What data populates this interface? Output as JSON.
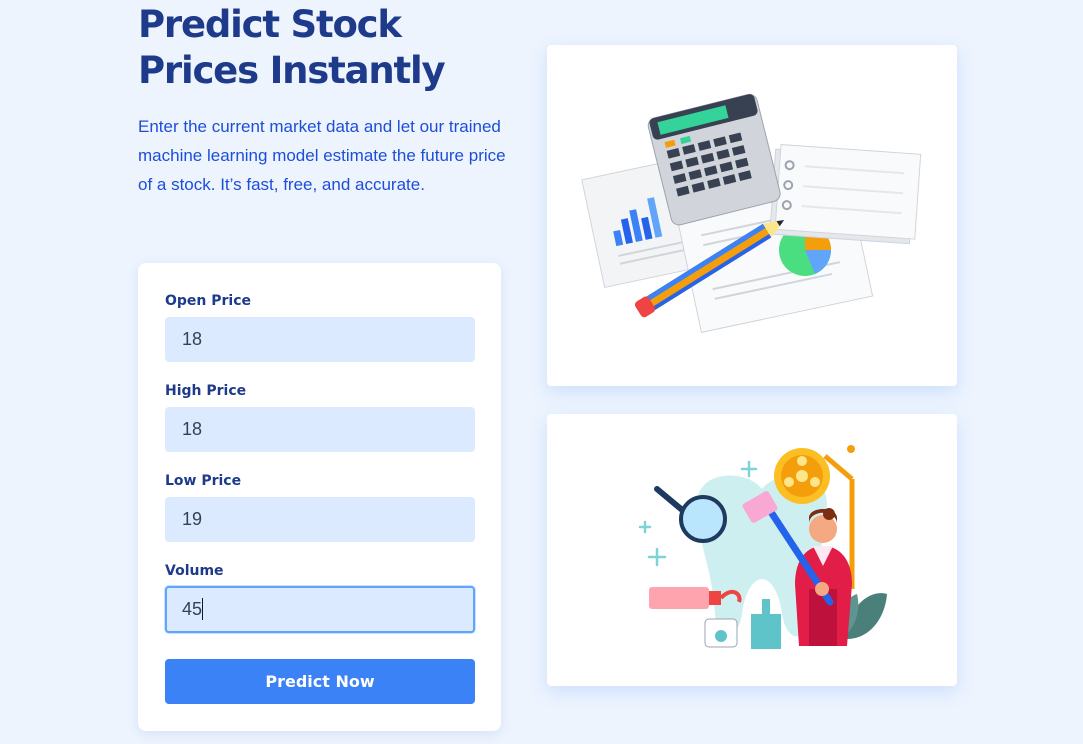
{
  "hero": {
    "title": "Predict Stock Prices Instantly",
    "description": "Enter the current market data and let our trained machine learning model estimate the future price of a stock. It’s fast, free, and accurate."
  },
  "form": {
    "fields": [
      {
        "label": "Open Price",
        "value": "18"
      },
      {
        "label": "High Price",
        "value": "18"
      },
      {
        "label": "Low Price",
        "value": "19"
      },
      {
        "label": "Volume",
        "value": "45"
      }
    ],
    "submit_label": "Predict Now"
  },
  "illustrations": [
    {
      "icon": "finance-calculator-illustration"
    },
    {
      "icon": "dentist-illustration"
    }
  ],
  "colors": {
    "background": "#edf4fe",
    "heading": "#1e3a8a",
    "accent": "#3b82f6",
    "input_bg": "#dbeafe"
  }
}
